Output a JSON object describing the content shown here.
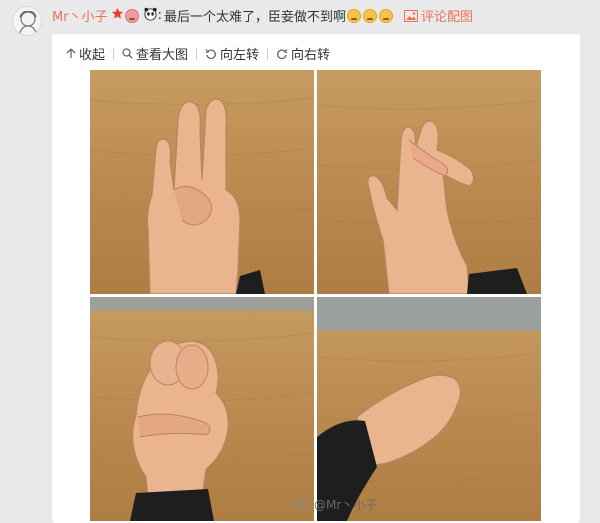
{
  "comment": {
    "user_name": "Mr丶小子",
    "separator": ":",
    "text": "最后一个太难了，臣妾做不到啊",
    "photo_link_label": "评论配图",
    "icons": [
      "star-badge-icon",
      "wink-face-icon",
      "panda-icon",
      "crying-face-icon",
      "crying-face-icon",
      "crying-face-icon",
      "picture-icon"
    ]
  },
  "toolbar": {
    "collapse_label": "收起",
    "view_large_label": "查看大图",
    "rotate_left_label": "向左转",
    "rotate_right_label": "向右转"
  },
  "watermark": {
    "text": "@Mr丶小子"
  },
  "colors": {
    "background": "#e9e9ec",
    "card": "#ffffff",
    "link_orange": "#eb7350",
    "wood": "#c79c61",
    "skin": "#e9b48e",
    "sleeve": "#1e1e1e"
  }
}
